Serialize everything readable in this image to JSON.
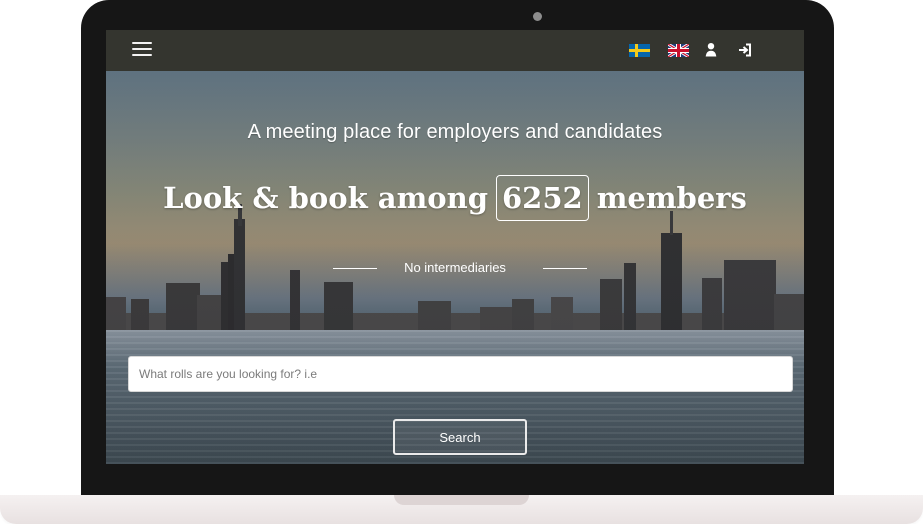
{
  "header": {
    "menu_icon": "hamburger-menu-icon",
    "languages": [
      {
        "name": "Swedish",
        "icon": "sweden-flag-icon"
      },
      {
        "name": "English",
        "icon": "uk-flag-icon"
      }
    ],
    "account_icon": "user-icon",
    "login_icon": "sign-in-icon"
  },
  "hero": {
    "subtitle": "A meeting place for employers and candidates",
    "headline_prefix": "Look & book among",
    "member_count": "6252",
    "headline_suffix": "members",
    "tagline": "No intermediaries"
  },
  "search": {
    "placeholder": "What rolls are you looking for? i.e",
    "button_label": "Search"
  },
  "colors": {
    "topbar": "#34352f",
    "laptop_frame": "#161616",
    "text": "#ffffff"
  }
}
